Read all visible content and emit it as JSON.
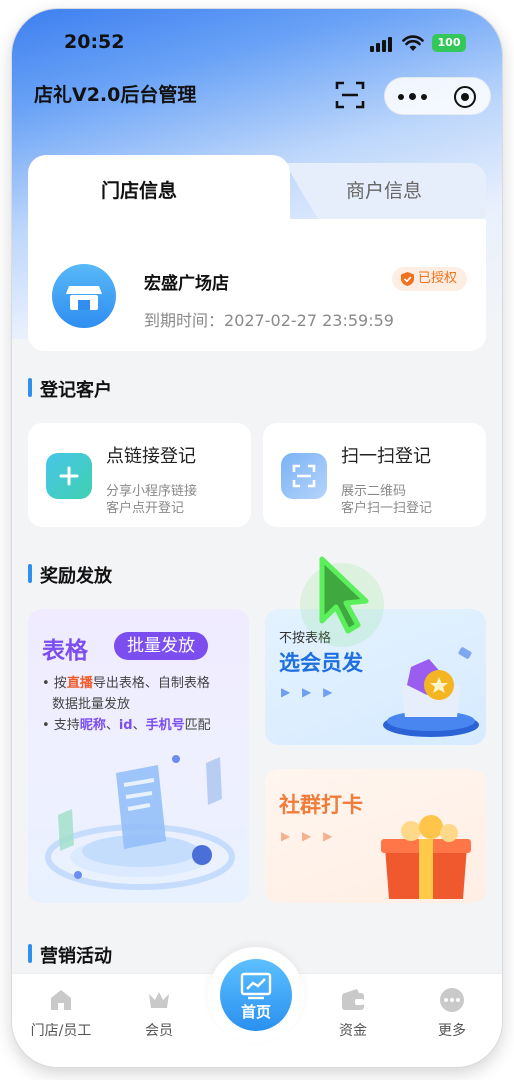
{
  "status_bar": {
    "time": "20:52",
    "battery": "100"
  },
  "nav": {
    "title": "店礼V2.0后台管理"
  },
  "store_tabs": {
    "active": "门店信息",
    "inactive": "商户信息"
  },
  "store": {
    "name": "宏盛广场店",
    "badge": "已授权",
    "expire_label": "到期时间：",
    "expire_value": "2027-02-27 23:59:59"
  },
  "sections": {
    "register": "登记客户",
    "reward": "奖励发放",
    "marketing": "营销活动"
  },
  "register_cards": [
    {
      "title": "点链接登记",
      "desc1": "分享小程序链接",
      "desc2": "客户点开登记"
    },
    {
      "title": "扫一扫登记",
      "desc1": "展示二维码",
      "desc2": "客户扫一扫登记"
    }
  ],
  "reward_table": {
    "big": "表格",
    "pill": "批量发放",
    "line1_a": "• 按",
    "line1_hl": "直播",
    "line1_b": "导出表格、自制表格",
    "line2": "数据批量发放",
    "line3_a": "• 支持",
    "line3_hl1": "昵称",
    "line3_sep1": "、",
    "line3_hl2": "id",
    "line3_sep2": "、",
    "line3_hl3": "手机号",
    "line3_b": "匹配"
  },
  "reward_member": {
    "small": "不按表格",
    "big": "选会员发",
    "arrows": "▶ ▶ ▶"
  },
  "reward_group": {
    "big": "社群打卡",
    "arrows": "▶ ▶ ▶"
  },
  "tabbar": {
    "items": [
      {
        "label": "门店/员工",
        "icon": "store-icon"
      },
      {
        "label": "会员",
        "icon": "crown-icon"
      },
      {
        "label": "首页",
        "icon": "chart-icon"
      },
      {
        "label": "资金",
        "icon": "wallet-icon"
      },
      {
        "label": "更多",
        "icon": "more-icon"
      }
    ]
  },
  "colors": {
    "accent": "#2f8ef0",
    "purple": "#7c4ef0",
    "orange": "#f07c3a",
    "badge_orange": "#f0721e"
  }
}
